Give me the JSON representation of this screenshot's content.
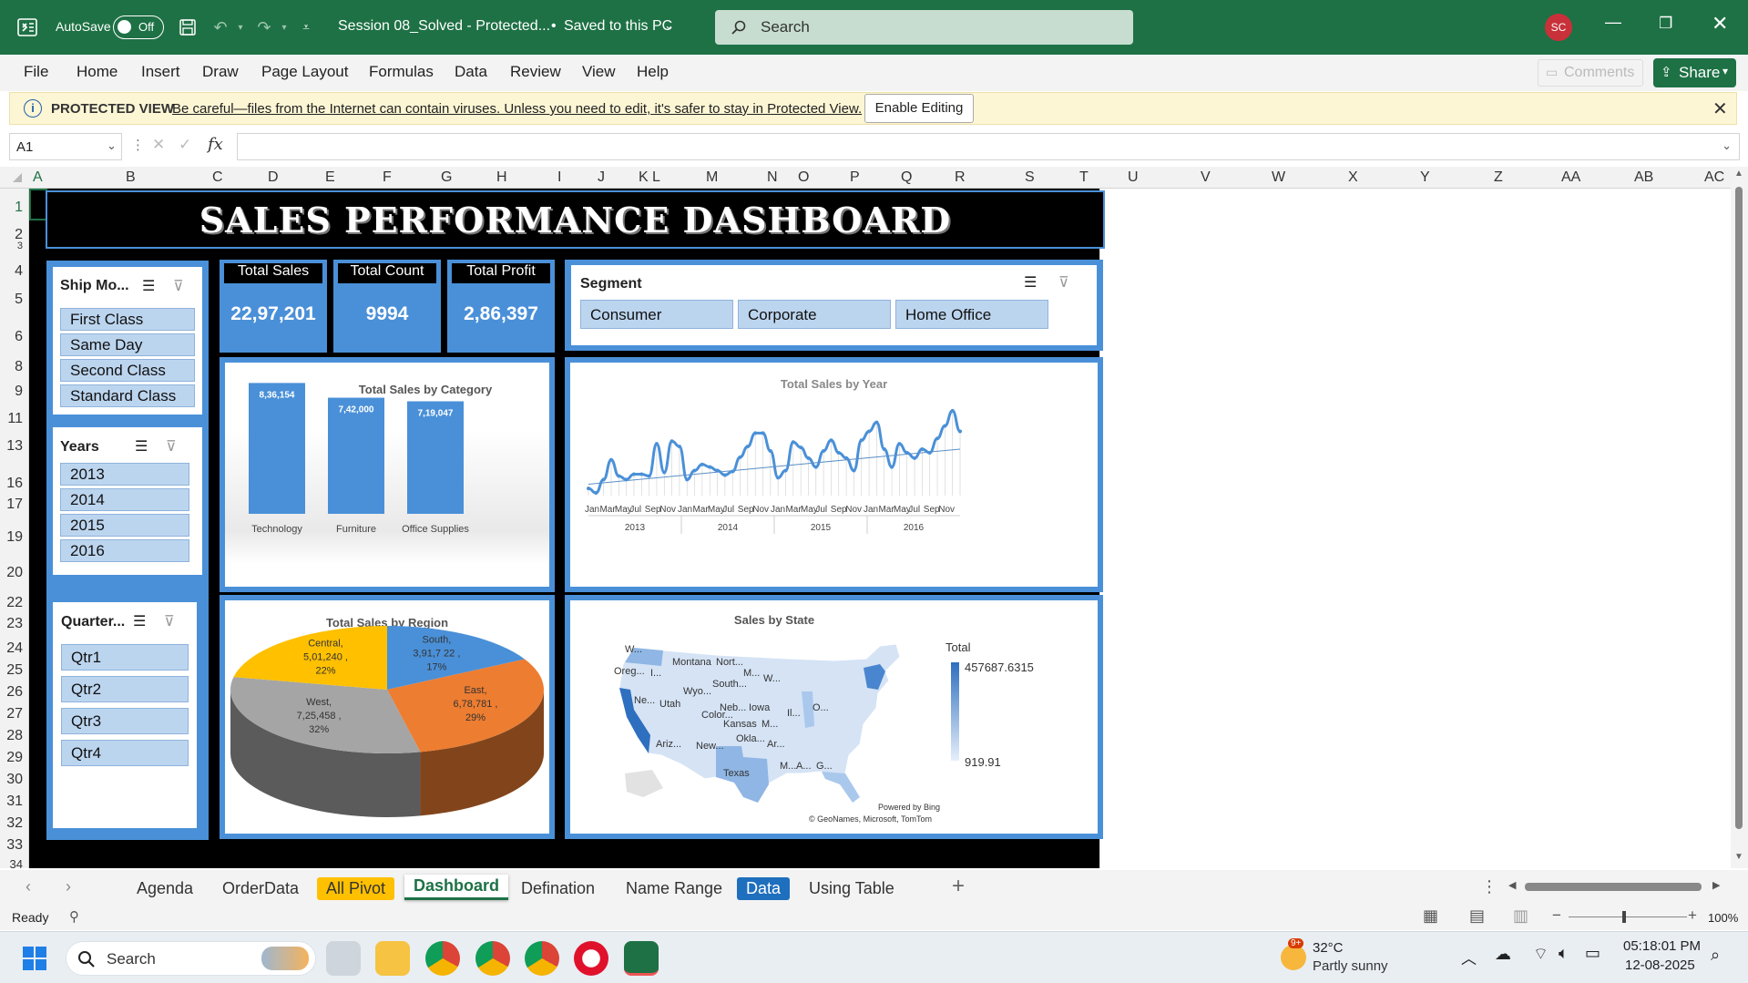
{
  "window": {
    "autosave_label": "AutoSave",
    "autosave_state": "Off",
    "doc_title": "Session 08_Solved  -  Protected...",
    "saved_status": "Saved to this PC",
    "search_placeholder": "Search",
    "avatar_initials": "SC"
  },
  "ribbon": {
    "tabs": [
      "File",
      "Home",
      "Insert",
      "Draw",
      "Page Layout",
      "Formulas",
      "Data",
      "Review",
      "View",
      "Help"
    ],
    "comments_label": "Comments",
    "share_label": "Share"
  },
  "protected_view": {
    "label": "PROTECTED VIEW",
    "message": "Be careful—files from the Internet can contain viruses. Unless you need to edit, it's safer to stay in Protected View.",
    "button": "Enable Editing"
  },
  "formula_bar": {
    "name_box": "A1",
    "fx": "fx",
    "formula": ""
  },
  "columns": [
    "A",
    "B",
    "C",
    "D",
    "E",
    "F",
    "G",
    "H",
    "I",
    "J",
    "K",
    "L",
    "M",
    "N",
    "O",
    "P",
    "Q",
    "R",
    "S",
    "T",
    "U",
    "V",
    "W",
    "X",
    "Y",
    "Z",
    "AA",
    "AB",
    "AC"
  ],
  "rows": [
    "1",
    "2",
    "3",
    "4",
    "5",
    "6",
    "8",
    "9",
    "11",
    "13",
    "16",
    "17",
    "19",
    "20",
    "22",
    "23",
    "24",
    "25",
    "26",
    "27",
    "28",
    "29",
    "30",
    "31",
    "32",
    "33",
    "34"
  ],
  "dashboard": {
    "title": "SALES PERFORMANCE DASHBOARD",
    "ship_mode": {
      "title": "Ship Mo...",
      "items": [
        "First Class",
        "Same Day",
        "Second Class",
        "Standard Class"
      ]
    },
    "years": {
      "title": "Years",
      "items": [
        "2013",
        "2014",
        "2015",
        "2016"
      ]
    },
    "quarters": {
      "title": "Quarter...",
      "items": [
        "Qtr1",
        "Qtr2",
        "Qtr3",
        "Qtr4"
      ]
    },
    "segment": {
      "title": "Segment",
      "items": [
        "Consumer",
        "Corporate",
        "Home Office"
      ]
    },
    "kpis": [
      {
        "label": "Total Sales",
        "value": "22,97,201"
      },
      {
        "label": "Total Count",
        "value": "9994"
      },
      {
        "label": "Total Profit",
        "value": "2,86,397"
      }
    ]
  },
  "chart_data": [
    {
      "type": "bar",
      "title": "Total Sales by Category",
      "categories": [
        "Technology",
        "Furniture",
        "Office Supplies"
      ],
      "values": [
        836154,
        742000,
        719047
      ],
      "data_labels": [
        "8,36,154",
        "7,42,000",
        "7,19,047"
      ],
      "color": "#4a90d8"
    },
    {
      "type": "line",
      "title": "Total Sales by Year",
      "years": [
        "2013",
        "2014",
        "2015",
        "2016"
      ],
      "month_labels": [
        "Jan",
        "Mar",
        "May",
        "Jul",
        "Sep",
        "Nov"
      ],
      "values": [
        8,
        3,
        18,
        40,
        22,
        18,
        24,
        24,
        22,
        58,
        26,
        61,
        55,
        18,
        28,
        35,
        32,
        28,
        23,
        27,
        43,
        55,
        70,
        70,
        50,
        20,
        28,
        60,
        54,
        42,
        32,
        50,
        62,
        48,
        42,
        28,
        62,
        72,
        82,
        52,
        32,
        58,
        48,
        42,
        52,
        48,
        64,
        78,
        95,
        72
      ],
      "trendline": true,
      "color": "#4a90d8"
    },
    {
      "type": "pie",
      "title": "Total Sales by Region",
      "slices": [
        {
          "label": "South",
          "value": 391722,
          "text": "3,91,7 22 ,",
          "pct": "17%",
          "color": "#4a90d8"
        },
        {
          "label": "East",
          "value": 678781,
          "text": "6,78,781 ,",
          "pct": "29%",
          "color": "#ed7d31"
        },
        {
          "label": "West",
          "value": 725458,
          "text": "7,25,458 ,",
          "pct": "32%",
          "color": "#a5a5a5"
        },
        {
          "label": "Central",
          "value": 501240,
          "text": "5,01,240 ,",
          "pct": "22%",
          "color": "#ffc000"
        }
      ]
    }
  ],
  "map": {
    "title": "Sales by State",
    "legend_title": "Total",
    "legend_max": "457687.6315",
    "legend_min": "919.91",
    "labels": [
      "W...",
      "Oreg...",
      "I...",
      "Montana",
      "Nort...",
      "M...",
      "W...",
      "South...",
      "Wyo...",
      "Ne...",
      "Utah",
      "Neb...",
      "Iowa",
      "Il...",
      "O...",
      "Color...",
      "Kansas",
      "M...",
      "Okla...",
      "Ar...",
      "Ariz...",
      "New...",
      "Texas",
      "M...",
      "A...",
      "G..."
    ],
    "credit1": "Powered by Bing",
    "credit2": "© GeoNames, Microsoft, TomTom"
  },
  "sheet_tabs": [
    {
      "label": "Agenda",
      "style": "normal"
    },
    {
      "label": "OrderData",
      "style": "normal"
    },
    {
      "label": "All Pivot",
      "style": "yellow"
    },
    {
      "label": "Dashboard",
      "style": "active"
    },
    {
      "label": "Defination",
      "style": "normal"
    },
    {
      "label": "Name Range",
      "style": "normal"
    },
    {
      "label": "Data",
      "style": "blue"
    },
    {
      "label": "Using Table",
      "style": "normal"
    }
  ],
  "status": {
    "ready": "Ready",
    "zoom": "100%"
  },
  "taskbar": {
    "search": "Search",
    "weather_temp": "32°C",
    "weather_desc": "Partly sunny",
    "weather_badge": "9+",
    "time": "05:18:01 PM",
    "date": "12-08-2025"
  },
  "colors": {
    "excel_green": "#1e7145",
    "panel_blue": "#4a90d8",
    "slicer_item": "#bcd5ef"
  }
}
